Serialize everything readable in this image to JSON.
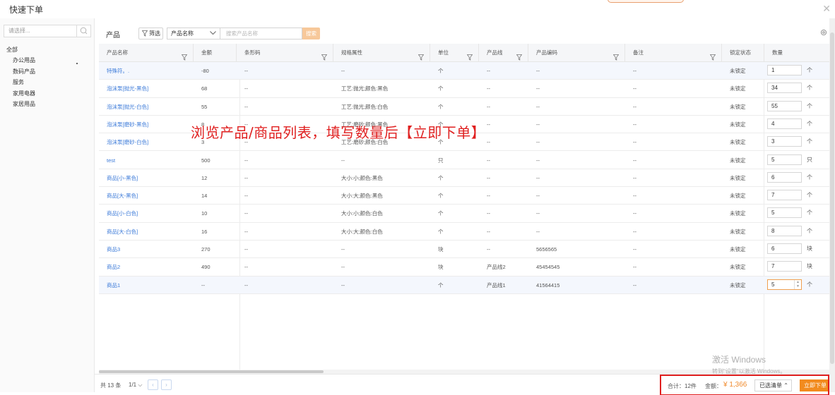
{
  "window": {
    "title": "快速下单",
    "close_icon": "close-icon"
  },
  "sidebar": {
    "search_placeholder": "请选择...",
    "root": "全部",
    "categories": [
      "办公用品",
      "数码产品",
      "服务",
      "家用电器",
      "家居用品"
    ]
  },
  "toolbar": {
    "label": "产品",
    "filter_label": "筛选",
    "field_select": "产品名称",
    "search_placeholder": "搜索产品名称",
    "search_button": "搜索"
  },
  "table": {
    "columns": [
      "产品名称",
      "金额",
      "条形码",
      "规格属性",
      "单位",
      "产品线",
      "产品编码",
      "备注",
      "锁定状态",
      "数量"
    ],
    "rows": [
      {
        "name": "特殊符。.",
        "amount": "-80",
        "barcode": "--",
        "spec": "--",
        "unit": "个",
        "line": "--",
        "code": "--",
        "note": "--",
        "lock": "未锁定",
        "qty": "1",
        "qty_unit": "个"
      },
      {
        "name": "泡沫泵[抛光-黑色]",
        "amount": "68",
        "barcode": "--",
        "spec": "工艺:抛光;颜色:黑色",
        "unit": "个",
        "line": "--",
        "code": "--",
        "note": "--",
        "lock": "未锁定",
        "qty": "34",
        "qty_unit": "个"
      },
      {
        "name": "泡沫泵[抛光-白色]",
        "amount": "55",
        "barcode": "--",
        "spec": "工艺:抛光;颜色:白色",
        "unit": "个",
        "line": "--",
        "code": "--",
        "note": "--",
        "lock": "未锁定",
        "qty": "55",
        "qty_unit": "个"
      },
      {
        "name": "泡沫泵[磨砂-黑色]",
        "amount": "8",
        "barcode": "--",
        "spec": "工艺:磨砂;颜色:黑色",
        "unit": "个",
        "line": "--",
        "code": "--",
        "note": "--",
        "lock": "未锁定",
        "qty": "4",
        "qty_unit": "个"
      },
      {
        "name": "泡沫泵[磨砂-白色]",
        "amount": "3",
        "barcode": "--",
        "spec": "工艺:磨砂;颜色:白色",
        "unit": "个",
        "line": "--",
        "code": "--",
        "note": "--",
        "lock": "未锁定",
        "qty": "3",
        "qty_unit": "个"
      },
      {
        "name": "test",
        "amount": "500",
        "barcode": "--",
        "spec": "--",
        "unit": "只",
        "line": "--",
        "code": "--",
        "note": "--",
        "lock": "未锁定",
        "qty": "5",
        "qty_unit": "只"
      },
      {
        "name": "商品[小-黑色]",
        "amount": "12",
        "barcode": "--",
        "spec": "大小:小;颜色:黑色",
        "unit": "个",
        "line": "--",
        "code": "--",
        "note": "--",
        "lock": "未锁定",
        "qty": "6",
        "qty_unit": "个"
      },
      {
        "name": "商品[大-黑色]",
        "amount": "14",
        "barcode": "--",
        "spec": "大小:大;颜色:黑色",
        "unit": "个",
        "line": "--",
        "code": "--",
        "note": "--",
        "lock": "未锁定",
        "qty": "7",
        "qty_unit": "个"
      },
      {
        "name": "商品[小-白色]",
        "amount": "10",
        "barcode": "--",
        "spec": "大小:小;颜色:白色",
        "unit": "个",
        "line": "--",
        "code": "--",
        "note": "--",
        "lock": "未锁定",
        "qty": "5",
        "qty_unit": "个"
      },
      {
        "name": "商品[大-白色]",
        "amount": "16",
        "barcode": "--",
        "spec": "大小:大;颜色:白色",
        "unit": "个",
        "line": "--",
        "code": "--",
        "note": "--",
        "lock": "未锁定",
        "qty": "8",
        "qty_unit": "个"
      },
      {
        "name": "商品3",
        "amount": "270",
        "barcode": "--",
        "spec": "--",
        "unit": "块",
        "line": "--",
        "code": "5656565",
        "note": "--",
        "lock": "未锁定",
        "qty": "6",
        "qty_unit": "块"
      },
      {
        "name": "商品2",
        "amount": "490",
        "barcode": "--",
        "spec": "--",
        "unit": "块",
        "line": "产品线2",
        "code": "45454545",
        "note": "--",
        "lock": "未锁定",
        "qty": "7",
        "qty_unit": "块"
      },
      {
        "name": "商品1",
        "amount": "--",
        "barcode": "--",
        "spec": "--",
        "unit": "个",
        "line": "产品线1",
        "code": "41564415",
        "note": "--",
        "lock": "未锁定",
        "qty": "5",
        "qty_unit": "个"
      }
    ]
  },
  "footer": {
    "total_count": "共 13 条",
    "page": "1/1",
    "sum_label": "合计：12件",
    "amount_label": "金额：",
    "amount_value": "¥ 1,366",
    "selected_list": "已选清单",
    "order_button": "立即下单"
  },
  "annotation": {
    "text": "浏览产品/商品列表，填写数量后【立即下单】"
  },
  "watermark": {
    "line1": "激活 Windows",
    "line2": "转到\"设置\"以激活 Windows。"
  },
  "colors": {
    "accent": "#f28b1e",
    "link": "#3d7bd9",
    "annotation": "#e02020"
  }
}
